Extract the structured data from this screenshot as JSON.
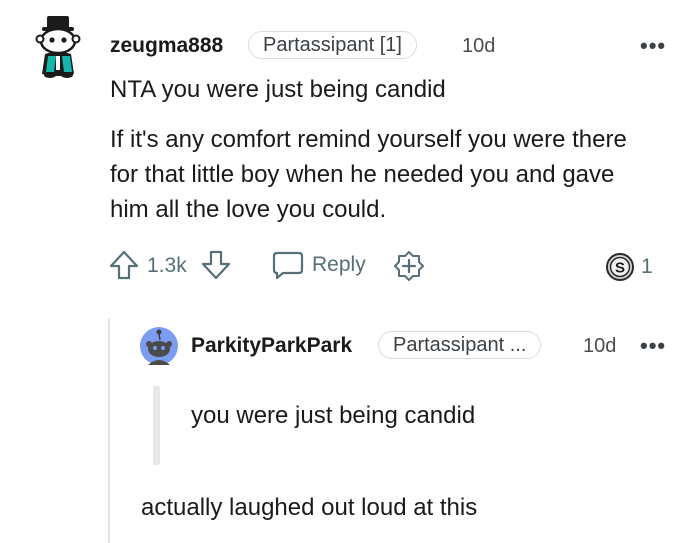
{
  "comment": {
    "avatar_icon": "snoo-top-hat-avatar-icon",
    "username": "zeugma888",
    "flair": "Partassipant [1]",
    "timestamp": "10d",
    "paragraphs": [
      "NTA you were just being candid",
      "If it's any comfort remind yourself you were there for that little boy when he needed you and gave him all the love you could."
    ],
    "upvote_icon": "upvote-arrow-icon",
    "votes": "1.3k",
    "downvote_icon": "downvote-arrow-icon",
    "reply_label": "Reply",
    "reply_icon": "speech-bubble-icon",
    "award_icon": "add-award-icon",
    "award_count": "1",
    "award_badge_icon": "silver-award-icon"
  },
  "reply": {
    "avatar_icon": "snoo-default-avatar-icon",
    "username": "ParkityParkPark",
    "flair": "Partassipant ...",
    "timestamp": "10d",
    "quote": "you were just being candid",
    "text": "actually laughed out loud at this"
  },
  "colors": {
    "text": "#1a1a1b",
    "meta": "#576f76",
    "flair_border": "#d9dde0",
    "reply_avatar_bg": "#7c9cf0"
  }
}
